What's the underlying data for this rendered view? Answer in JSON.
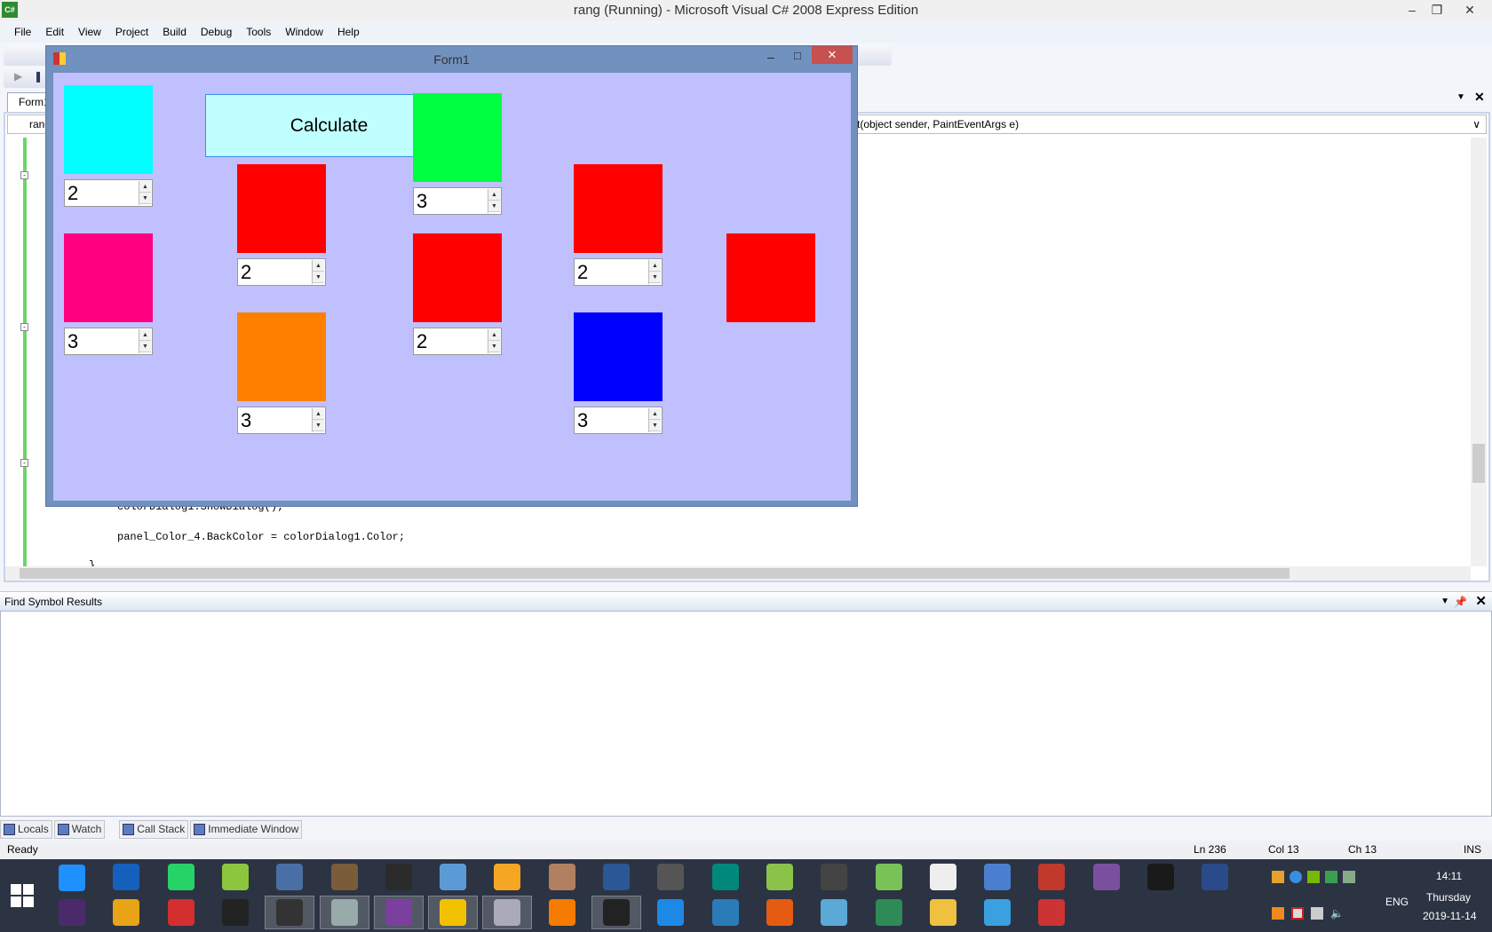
{
  "window": {
    "title": "rang (Running) - Microsoft Visual C# 2008 Express Edition",
    "icon": "csharp-icon"
  },
  "menu": [
    "File",
    "Edit",
    "View",
    "Project",
    "Build",
    "Debug",
    "Tools",
    "Window",
    "Help"
  ],
  "doc_tab": "Form1",
  "editor": {
    "type_combo": "rang.",
    "member_combo": "t(object sender, PaintEventArgs e)",
    "code_lines": [
      "colorDialog1.ShowDialog();",
      "panel_Color_4.BackColor = colorDialog1.Color;",
      "}"
    ]
  },
  "find_panel": {
    "title": "Find Symbol Results"
  },
  "bottom_tabs": [
    "Locals",
    "Watch",
    "Call Stack",
    "Immediate Window"
  ],
  "status": {
    "text": "Ready",
    "ln": "Ln 236",
    "col": "Col 13",
    "ch": "Ch 13",
    "mode": "INS"
  },
  "form1": {
    "title": "Form1",
    "calculate_label": "Calculate",
    "panels": [
      {
        "color": "#00ffff",
        "value": "2"
      },
      {
        "color": "#00ff40",
        "value": "3"
      },
      {
        "color": "#ff0000",
        "value": "2"
      },
      {
        "color": "#ff0080",
        "value": "3"
      },
      {
        "color": "#ff0000",
        "value": "2"
      },
      {
        "color": "#ff0000",
        "value": "2"
      },
      {
        "color": "#ff0000",
        "value": null
      },
      {
        "color": "#ff8000",
        "value": "3"
      },
      {
        "color": "#0000ff",
        "value": "3"
      }
    ],
    "client_bg": "#c0c0ff"
  },
  "tray": {
    "lang": "ENG",
    "time": "14:11",
    "day": "Thursday",
    "date": "2019-11-14"
  }
}
